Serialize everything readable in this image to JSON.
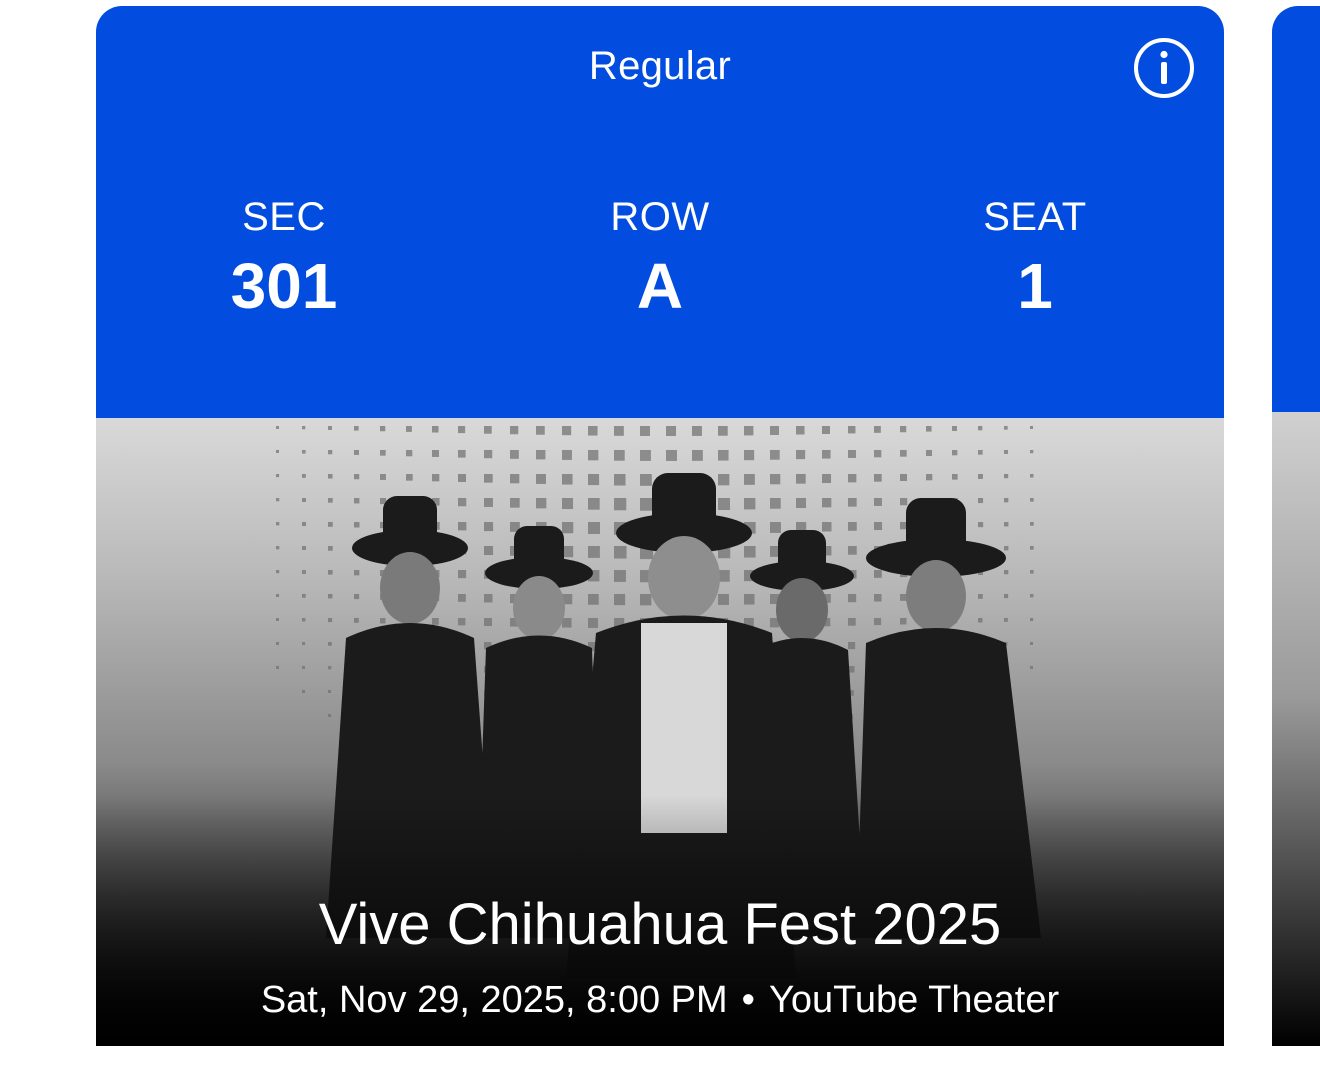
{
  "ticket": {
    "type_label": "Regular",
    "info_icon": "info-circle-icon",
    "section": {
      "label": "SEC",
      "value": "301"
    },
    "row": {
      "label": "ROW",
      "value": "A"
    },
    "seat": {
      "label": "SEAT",
      "value": "1"
    },
    "event": {
      "title": "Vive Chihuahua Fest 2025",
      "datetime": "Sat, Nov 29, 2025, 8:00 PM",
      "separator": "•",
      "venue": "YouTube Theater"
    }
  },
  "colors": {
    "header_blue": "#024ddf",
    "text_white": "#ffffff"
  }
}
